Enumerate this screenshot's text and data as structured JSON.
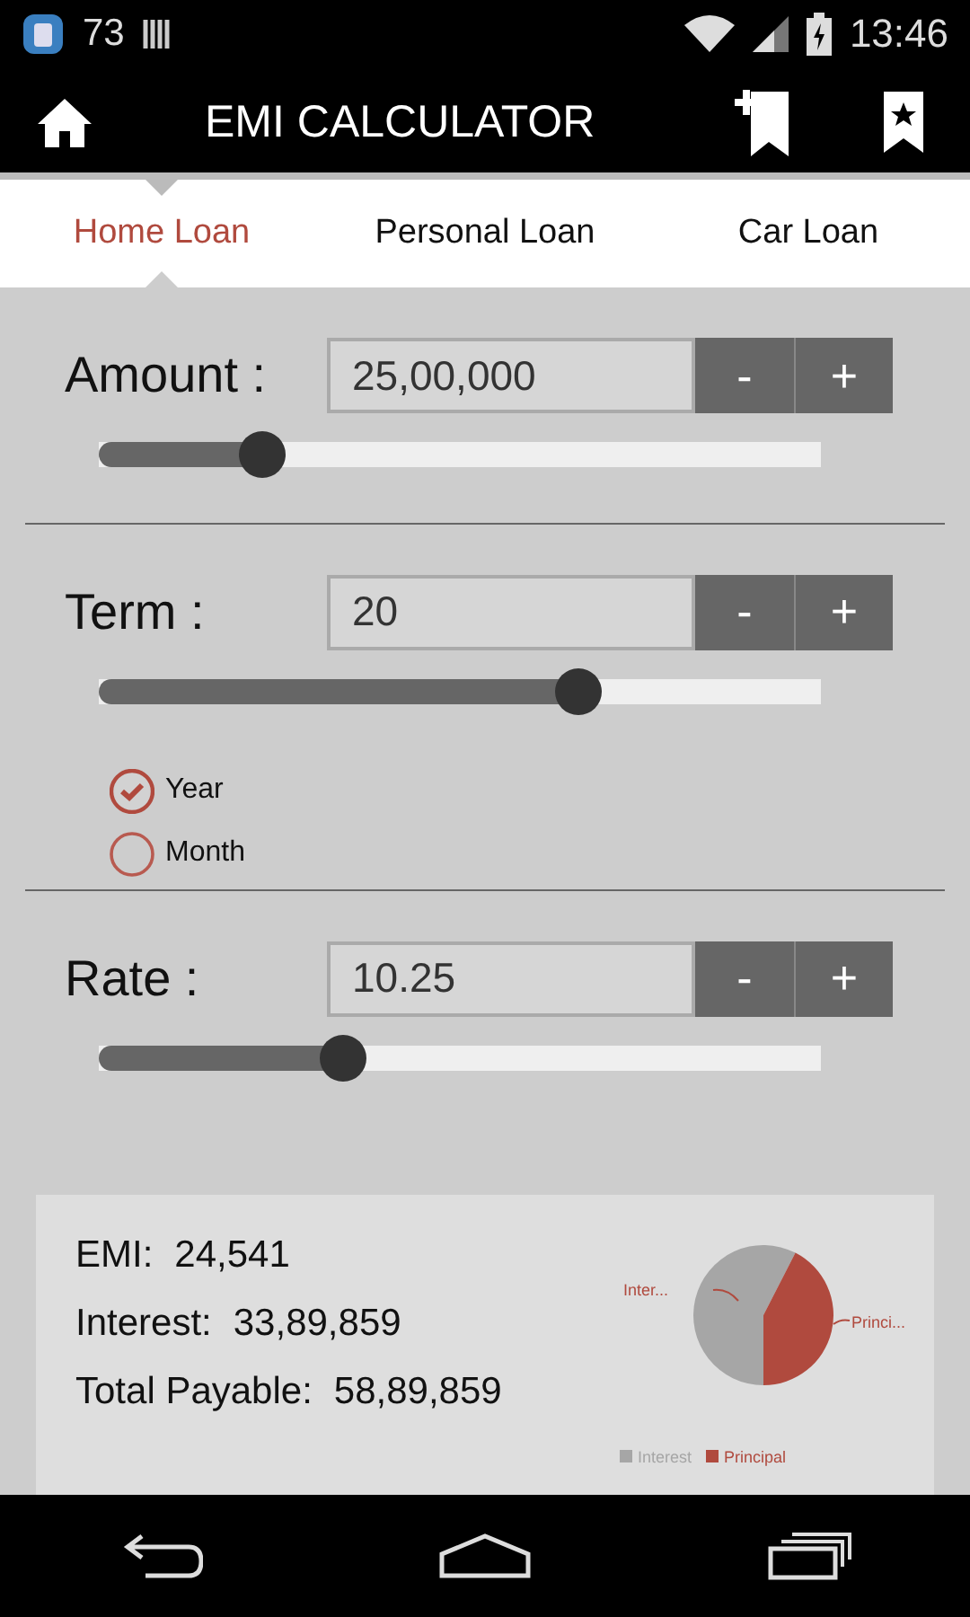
{
  "status_bar": {
    "notification_count": "73",
    "time": "13:46"
  },
  "app_bar": {
    "title": "EMI CALCULATOR"
  },
  "tabs": [
    {
      "label": "Home Loan",
      "selected": true
    },
    {
      "label": "Personal Loan",
      "selected": false
    },
    {
      "label": "Car Loan",
      "selected": false
    }
  ],
  "inputs": [
    {
      "label": "Amount :",
      "value": "25,00,000",
      "minus": "-",
      "plus": "+",
      "level": 0.226
    },
    {
      "label": "Term :",
      "value": "20",
      "minus": "-",
      "plus": "+",
      "level": 0.663,
      "units": [
        {
          "label": "Year",
          "selected": true
        },
        {
          "label": "Month",
          "selected": false
        }
      ]
    },
    {
      "label": "Rate :",
      "value": "10.25",
      "minus": "-",
      "plus": "+",
      "level": 0.338
    }
  ],
  "results": [
    {
      "label": "EMI:",
      "value": "24,541"
    },
    {
      "label": "Interest:",
      "value": "33,89,859"
    },
    {
      "label": "Total Payable:",
      "value": "58,89,859"
    }
  ],
  "chart": {
    "slices": [
      {
        "callout": "Inter...",
        "color": "#a6a6a6"
      },
      {
        "callout": "Princi...",
        "color": "#b04a3e"
      }
    ],
    "chart_data": {
      "type": "pie",
      "categories": [
        "Interest",
        "Principal"
      ],
      "values": [
        57.55,
        42.45
      ],
      "legend": "bottom"
    }
  }
}
